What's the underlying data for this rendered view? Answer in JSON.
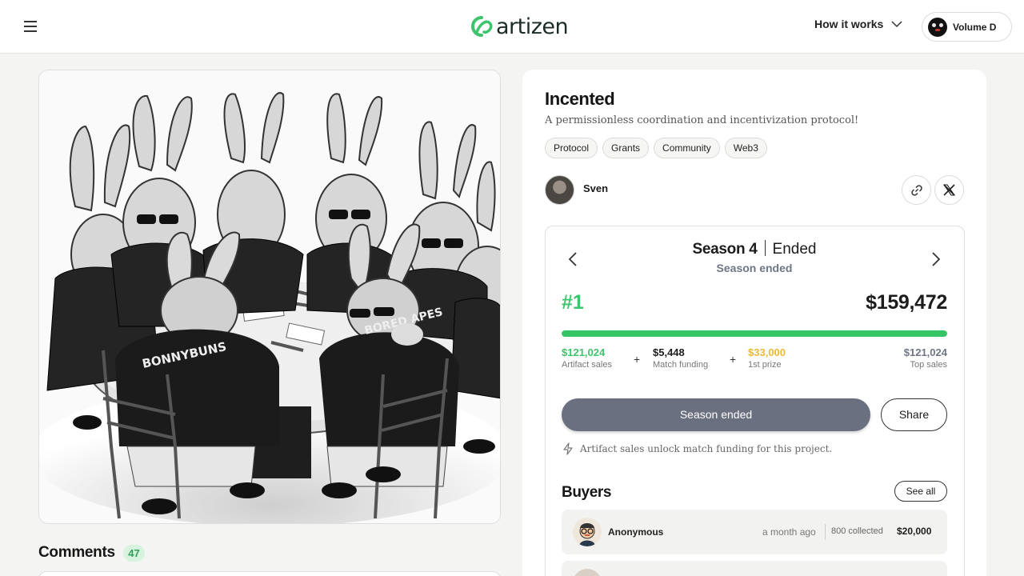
{
  "header": {
    "logo_text": "artizen",
    "how_it_works": "How it works",
    "user_name": "Volume D",
    "brand_color": "#3ec46d"
  },
  "artwork": {
    "jacket_text_left": "BONNYBUNS",
    "jacket_text_right": "BORED APES"
  },
  "comments": {
    "title": "Comments",
    "count": "47"
  },
  "project": {
    "title": "Incented",
    "description": "A permissionless coordination and incentivization protocol!",
    "tags": [
      "Protocol",
      "Grants",
      "Community",
      "Web3"
    ],
    "creator": "Sven"
  },
  "season": {
    "name": "Season 4",
    "state": "Ended",
    "status": "Season ended",
    "rank": "#1",
    "total": "$159,472",
    "progress_percent": 100,
    "stats": [
      {
        "value": "$121,024",
        "label": "Artifact sales",
        "color": "#3ec46d"
      },
      {
        "value": "$5,448",
        "label": "Match funding",
        "color": "#1c1c1c"
      },
      {
        "value": "$33,000",
        "label": "1st prize",
        "color": "#e9b93a"
      },
      {
        "value": "$121,024",
        "label": "Top sales",
        "color": "#6f7585"
      }
    ],
    "primary_button": "Season ended",
    "share_button": "Share",
    "note": "Artifact sales unlock match funding for this project."
  },
  "buyers": {
    "title": "Buyers",
    "see_all": "See all",
    "rows": [
      {
        "name": "Anonymous",
        "time": "a month ago",
        "collected": "800 collected",
        "amount": "$20,000"
      }
    ]
  }
}
